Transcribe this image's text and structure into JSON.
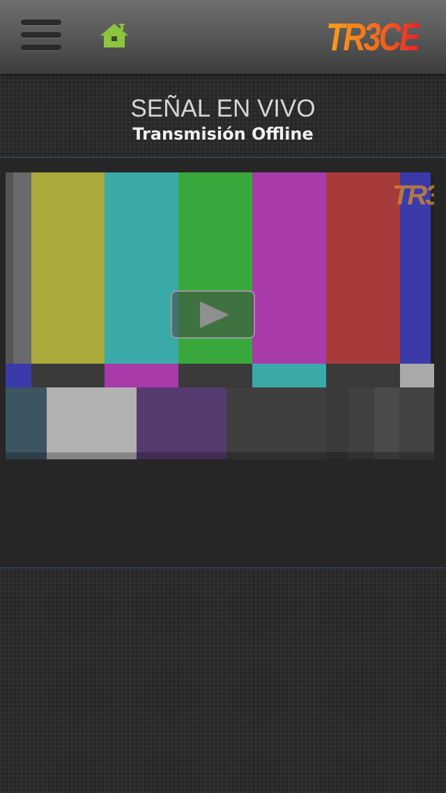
{
  "header": {
    "menu_icon": "hamburger-menu-icon",
    "home_icon": "home-icon",
    "home_color": "#8cc63f",
    "logo_text": "TR3CE"
  },
  "stream": {
    "title": "SEÑAL EN VIVO",
    "status": "Transmisión Offline"
  },
  "player": {
    "play_icon": "play-icon",
    "watermark_text": "TR3",
    "test_pattern_colors": [
      "#a9a9a9",
      "#aaa93c",
      "#3aaaa9",
      "#39a83c",
      "#a93aa9",
      "#a83a3a",
      "#3a3aa9"
    ]
  },
  "colors": {
    "divider": "#3b4a7a"
  }
}
